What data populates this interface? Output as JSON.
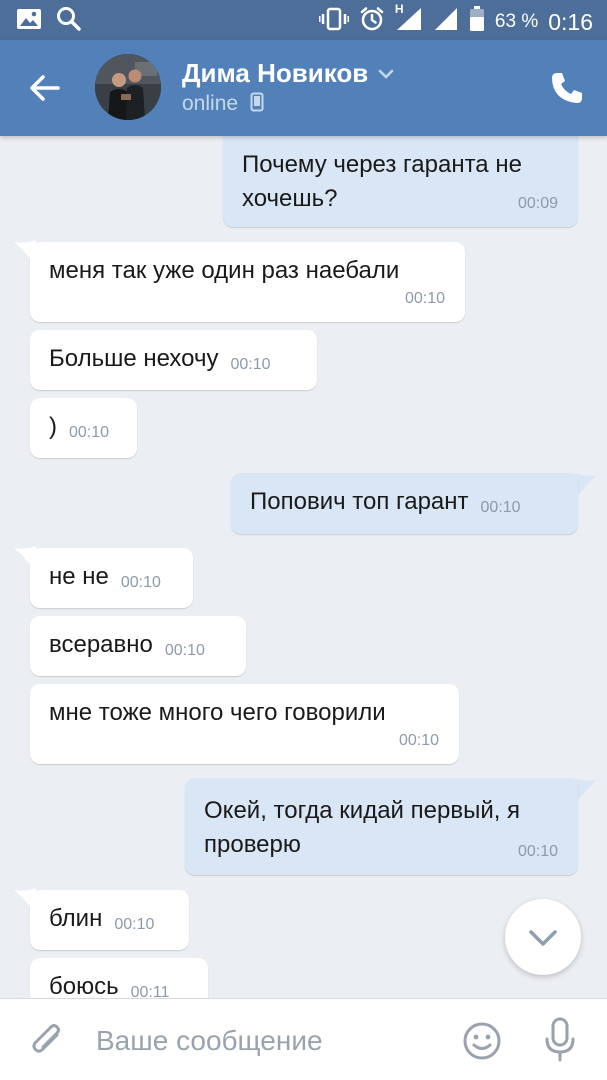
{
  "status_bar": {
    "battery": "63 %",
    "time": "0:16",
    "network": "H"
  },
  "header": {
    "contact_name": "Дима Новиков",
    "contact_status": "online"
  },
  "messages": [
    {
      "dir": "out",
      "text": "Почему через гаранта не хочешь?",
      "time": "00:09"
    },
    {
      "dir": "in",
      "text": "меня так уже один раз наебали",
      "time": "00:10"
    },
    {
      "dir": "in",
      "text": "Больше нехочу",
      "time": "00:10"
    },
    {
      "dir": "in",
      "text": ")",
      "time": "00:10"
    },
    {
      "dir": "out",
      "text": "Попович топ гарант",
      "time": "00:10"
    },
    {
      "dir": "in",
      "text": "не не",
      "time": "00:10"
    },
    {
      "dir": "in",
      "text": "всеравно",
      "time": "00:10"
    },
    {
      "dir": "in",
      "text": "мне тоже много чего говорили",
      "time": "00:10"
    },
    {
      "dir": "out",
      "text": "Окей, тогда кидай первый, я проверю",
      "time": "00:10"
    },
    {
      "dir": "in",
      "text": "блин",
      "time": "00:10"
    },
    {
      "dir": "in",
      "text": "боюсь",
      "time": "00:11"
    }
  ],
  "composer": {
    "placeholder": "Ваше сообщение"
  },
  "icons": {
    "status_left": [
      "gallery-icon",
      "search-icon"
    ],
    "status_right": [
      "vibrate-icon",
      "alarm-icon",
      "signal-icon",
      "battery-icon"
    ],
    "header": [
      "back-arrow-icon",
      "chevron-down-icon",
      "mobile-device-icon",
      "phone-icon"
    ],
    "composer": [
      "paperclip-icon",
      "smile-icon",
      "microphone-icon"
    ],
    "floating": [
      "chevron-down-icon"
    ]
  },
  "colors": {
    "header": "#5181b8",
    "status_bar": "#4d6e99",
    "chat_background": "#ebeef2",
    "incoming_bubble": "#ffffff",
    "outgoing_bubble": "#d8e6f5"
  }
}
